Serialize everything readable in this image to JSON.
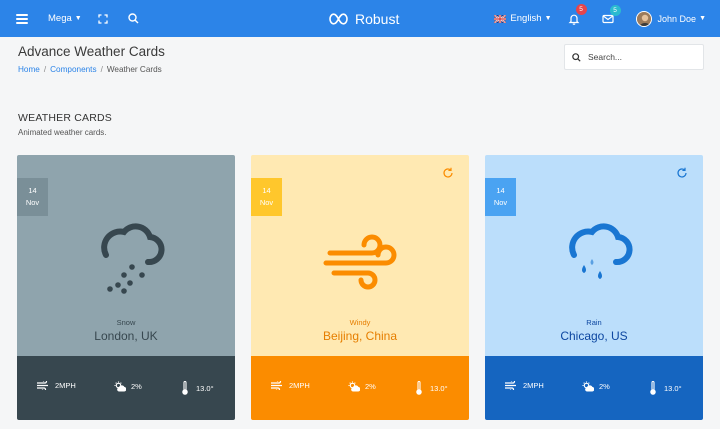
{
  "navbar": {
    "mega_label": "Mega",
    "brand": "Robust",
    "language": "English",
    "notifications_count": "5",
    "messages_count": "5",
    "user_name": "John Doe"
  },
  "header": {
    "title": "Advance Weather Cards",
    "breadcrumb": [
      "Home",
      "Components",
      "Weather Cards"
    ],
    "search_placeholder": "Search..."
  },
  "section": {
    "title": "WEATHER CARDS",
    "subtitle": "Animated weather cards."
  },
  "cards": [
    {
      "day": "14",
      "month": "Nov",
      "condition": "Snow",
      "city": "London, UK",
      "wind": "2MPH",
      "precip": "2%",
      "temp": "13.0°",
      "icon": "snow-cloud-icon",
      "colors": {
        "top": "#8fa4ad",
        "bottom": "#37474f",
        "tag": "#7a8f98",
        "icon": "#37474f",
        "text": "#37474f"
      }
    },
    {
      "day": "14",
      "month": "Nov",
      "condition": "Windy",
      "city": "Beijing, China",
      "wind": "2MPH",
      "precip": "2%",
      "temp": "13.0°",
      "icon": "wind-icon",
      "colors": {
        "top": "#ffe9b2",
        "bottom": "#fb8c00",
        "tag": "#ffc72c",
        "icon": "#fb8c00",
        "text": "#e67e00"
      }
    },
    {
      "day": "14",
      "month": "Nov",
      "condition": "Rain",
      "city": "Chicago, US",
      "wind": "2MPH",
      "precip": "2%",
      "temp": "13.0°",
      "icon": "rain-cloud-icon",
      "colors": {
        "top": "#bbdefb",
        "bottom": "#1565c0",
        "tag": "#4aa3f2",
        "icon": "#1976d2",
        "text": "#0d47a1"
      }
    }
  ]
}
